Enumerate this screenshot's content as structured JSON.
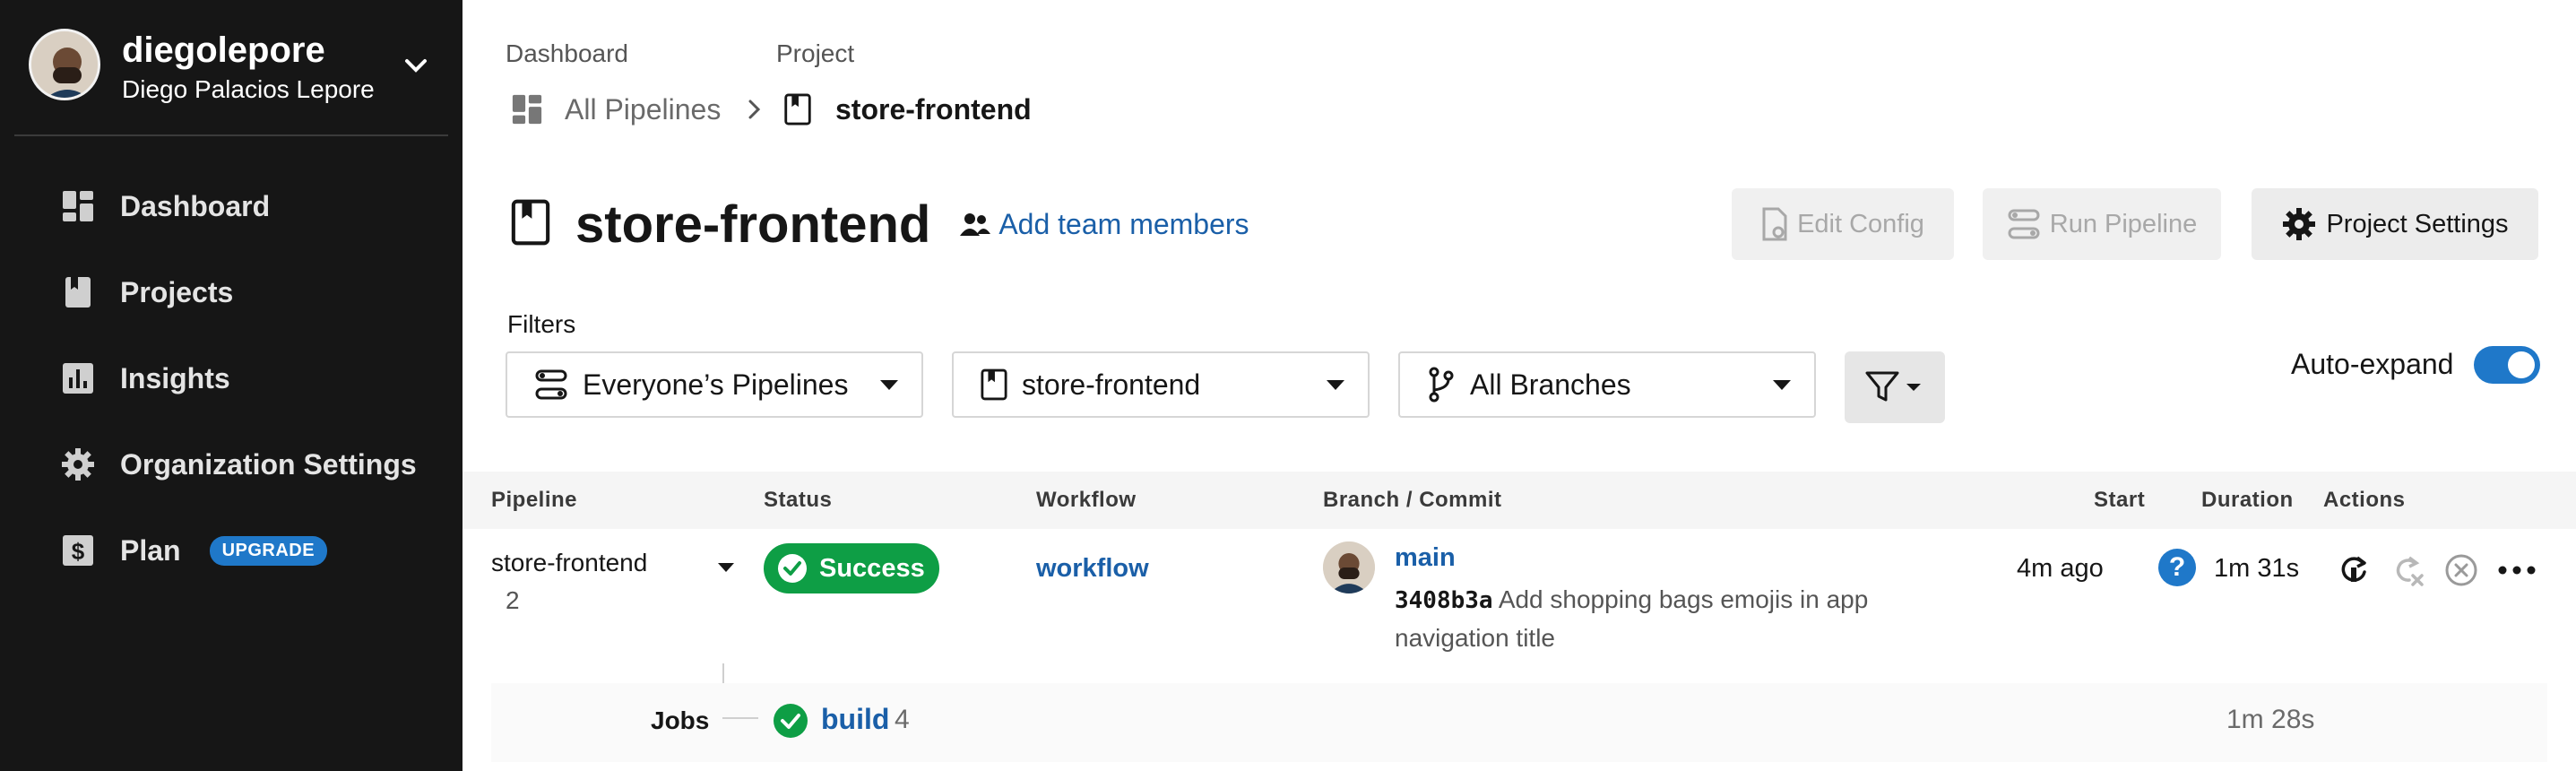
{
  "user": {
    "username": "diegolepore",
    "full_name": "Diego Palacios Lepore"
  },
  "sidebar": {
    "items": [
      {
        "label": "Dashboard",
        "icon": "dashboard-icon"
      },
      {
        "label": "Projects",
        "icon": "project-icon"
      },
      {
        "label": "Insights",
        "icon": "insights-icon"
      },
      {
        "label": "Organization Settings",
        "icon": "gear-icon"
      },
      {
        "label": "Plan",
        "icon": "dollar-icon",
        "badge": "UPGRADE"
      }
    ]
  },
  "breadcrumb": {
    "caption_1": "Dashboard",
    "caption_2": "Project",
    "link": "All Pipelines",
    "current": "store-frontend"
  },
  "header": {
    "title": "store-frontend",
    "add_team": "Add team members",
    "edit_config": "Edit Config",
    "run_pipeline": "Run Pipeline",
    "project_settings": "Project Settings"
  },
  "filters": {
    "label": "Filters",
    "owner": "Everyone’s Pipelines",
    "project": "store-frontend",
    "branch": "All Branches",
    "autoexpand_label": "Auto-expand",
    "autoexpand_on": true
  },
  "table": {
    "headers": [
      "Pipeline",
      "Status",
      "Workflow",
      "Branch / Commit",
      "Start",
      "Duration",
      "Actions"
    ],
    "row": {
      "pipeline": "store-frontend",
      "number": "2",
      "status": "Success",
      "workflow": "workflow",
      "branch": "main",
      "commit_hash": "3408b3a",
      "commit_message": "Add shopping bags emojis in app navigation title",
      "start": "4m ago",
      "duration": "1m 31s"
    },
    "jobs": {
      "label": "Jobs",
      "name": "build",
      "count": "4",
      "duration": "1m 28s"
    }
  },
  "colors": {
    "sidebar_bg": "#161616",
    "accent_blue": "#1f78c9",
    "link_blue": "#1a5fa8",
    "success_green": "#0e9e45"
  }
}
